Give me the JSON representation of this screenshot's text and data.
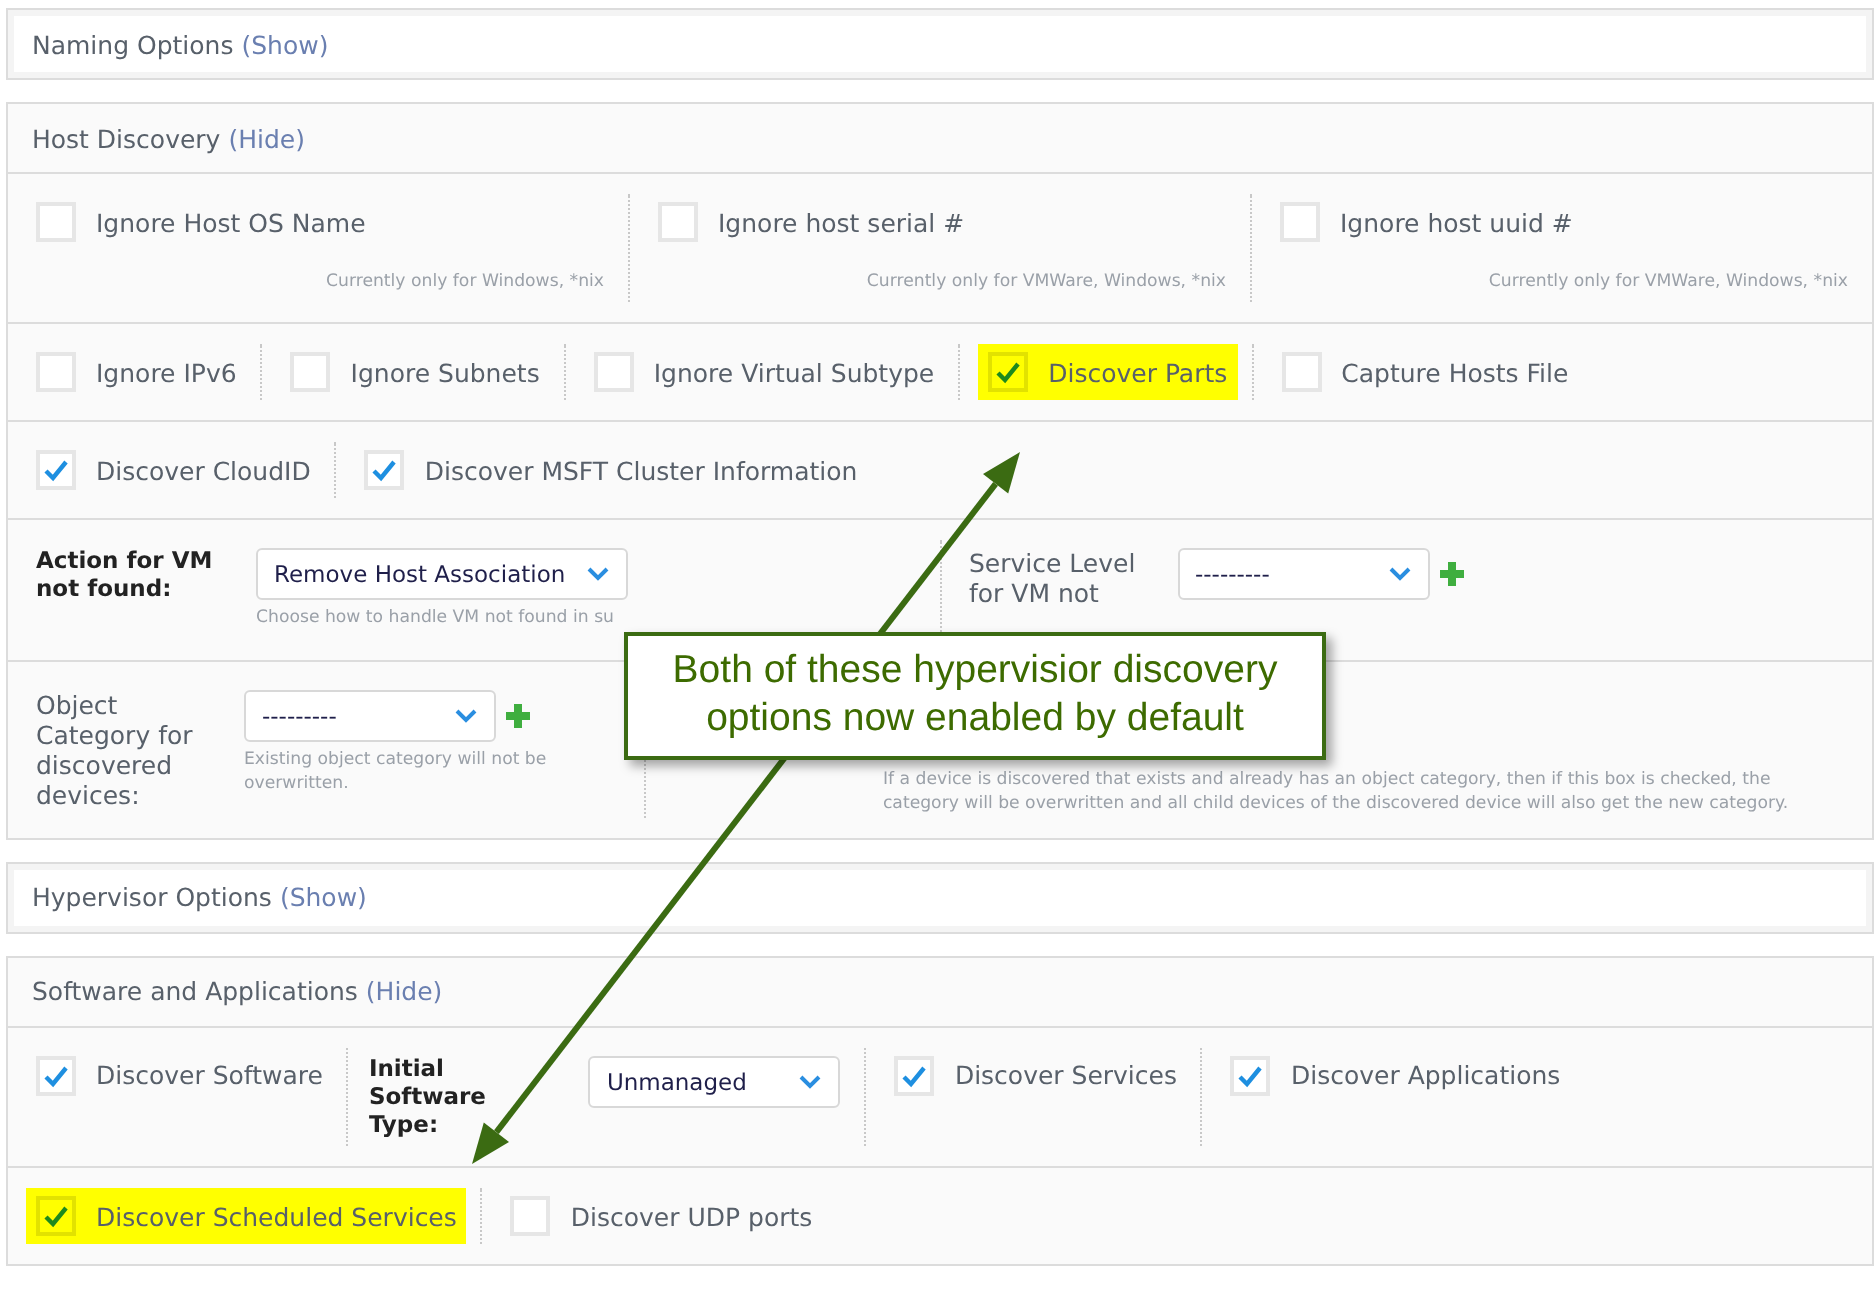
{
  "sections": [
    {
      "title": "Naming Options",
      "toggle": "(Show)"
    },
    {
      "title": "Host Discovery",
      "toggle": "(Hide)",
      "rows": [
        {
          "items": [
            {
              "kind": "checkbox",
              "label": "Ignore Host OS Name",
              "checked": false,
              "highlighted": false,
              "hint": "Currently only for Windows, *nix"
            },
            {
              "kind": "checkbox",
              "label": "Ignore host serial #",
              "checked": false,
              "highlighted": false,
              "hint": "Currently only for VMWare, Windows, *nix"
            },
            {
              "kind": "checkbox",
              "label": "Ignore host uuid #",
              "checked": false,
              "highlighted": false,
              "hint": "Currently only for VMWare, Windows, *nix"
            }
          ]
        },
        {
          "items": [
            {
              "kind": "checkbox",
              "label": "Ignore IPv6",
              "checked": false,
              "highlighted": false
            },
            {
              "kind": "checkbox",
              "label": "Ignore Subnets",
              "checked": false,
              "highlighted": false
            },
            {
              "kind": "checkbox",
              "label": "Ignore Virtual Subtype",
              "checked": false,
              "highlighted": false
            },
            {
              "kind": "checkbox",
              "label": "Discover Parts",
              "checked": true,
              "highlighted": true
            },
            {
              "kind": "checkbox",
              "label": "Capture Hosts File",
              "checked": false,
              "highlighted": false
            }
          ]
        },
        {
          "items": [
            {
              "kind": "checkbox",
              "label": "Discover CloudID",
              "checked": true,
              "highlighted": false
            },
            {
              "kind": "checkbox",
              "label": "Discover MSFT Cluster Information",
              "checked": true,
              "highlighted": false
            }
          ]
        },
        {
          "items": [
            {
              "kind": "select",
              "label": "Action for VM not found:",
              "bold": true,
              "value": "Remove Host Association",
              "hint": "Choose how to handle VM not found in su"
            },
            {
              "kind": "select",
              "label": "Service Level for VM not",
              "bold": false,
              "value": "---------",
              "actions": [
                {
                  "kind": "add"
                }
              ]
            }
          ]
        },
        {
          "items": [
            {
              "kind": "select",
              "label": "Object Category for discovered devices:",
              "bold": false,
              "value": "---------",
              "actions": [
                {
                  "kind": "add"
                }
              ],
              "hint": "Existing object category will not be overwritten."
            },
            {
              "kind": "note",
              "hint": "If a device is discovered that exists and already has an object category, then if this box is checked, the category will be overwritten and all child devices of the discovered device will also get the new category."
            }
          ]
        }
      ]
    },
    {
      "title": "Hypervisor Options",
      "toggle": "(Show)"
    },
    {
      "title": "Software and Applications",
      "toggle": "(Hide)",
      "rows": [
        {
          "items": [
            {
              "kind": "checkbox",
              "label": "Discover Software",
              "checked": true,
              "highlighted": false
            },
            {
              "kind": "select",
              "label": "Initial Software Type:",
              "bold": true,
              "value": "Unmanaged"
            },
            {
              "kind": "checkbox",
              "label": "Discover Services",
              "checked": true,
              "highlighted": false
            },
            {
              "kind": "checkbox",
              "label": "Discover Applications",
              "checked": true,
              "highlighted": false
            }
          ]
        },
        {
          "items": [
            {
              "kind": "checkbox",
              "label": "Discover Scheduled Services",
              "checked": true,
              "highlighted": true
            },
            {
              "kind": "checkbox",
              "label": "Discover UDP ports",
              "checked": false,
              "highlighted": false
            }
          ]
        }
      ]
    }
  ],
  "callout": {
    "text": "Both of these hypervisior discovery options now enabled by default"
  }
}
